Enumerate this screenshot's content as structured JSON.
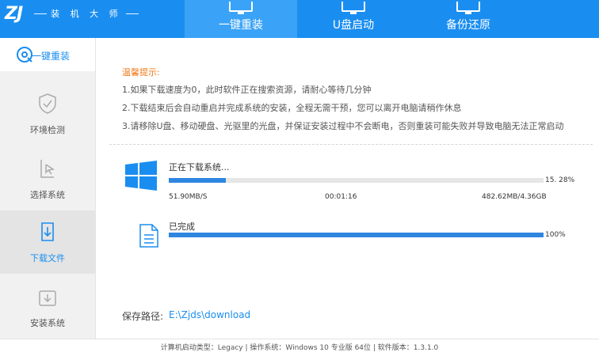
{
  "app": {
    "logo_text": "装 机 大 师"
  },
  "tabs": [
    {
      "label": "一键重装",
      "active": true
    },
    {
      "label": "U盘启动",
      "active": false
    },
    {
      "label": "备份还原",
      "active": false
    }
  ],
  "sidebar": {
    "items": [
      {
        "label": "一键重装",
        "icon": "reinstall-icon"
      },
      {
        "label": "环境检测",
        "icon": "shield-check-icon"
      },
      {
        "label": "选择系统",
        "icon": "cursor-select-icon"
      },
      {
        "label": "下载文件",
        "icon": "download-file-icon"
      },
      {
        "label": "安装系统",
        "icon": "install-icon"
      }
    ],
    "selected_index": 3
  },
  "tips": {
    "title": "温馨提示:",
    "lines": [
      "1.如果下载速度为0，此时软件正在搜索资源，请耐心等待几分钟",
      "2.下载结束后会自动重启并完成系统的安装，全程无需干预，您可以离开电脑请稍作休息",
      "3.请移除U盘、移动硬盘、光驱里的光盘，并保证安装过程中不会断电，否则重装可能失败并导致电脑无法正常启动"
    ]
  },
  "download": {
    "status": "正在下载系统...",
    "progress_text": "15. 28%",
    "progress_value": 15.28,
    "speed": "51.90MB/S",
    "elapsed": "00:01:16",
    "size": "482.62MB/4.36GB"
  },
  "complete": {
    "status": "已完成",
    "progress_text": "100%",
    "progress_value": 100
  },
  "save": {
    "label": "保存路径:",
    "path": "E:\\Zjds\\download"
  },
  "footer": {
    "text": "计算机启动类型：Legacy | 操作系统：Windows 10 专业版 64位 | 软件版本：1.3.1.0"
  },
  "colors": {
    "accent": "#1a8ef0",
    "tip_title": "#f07a1a",
    "progress": "#2f86e0"
  }
}
